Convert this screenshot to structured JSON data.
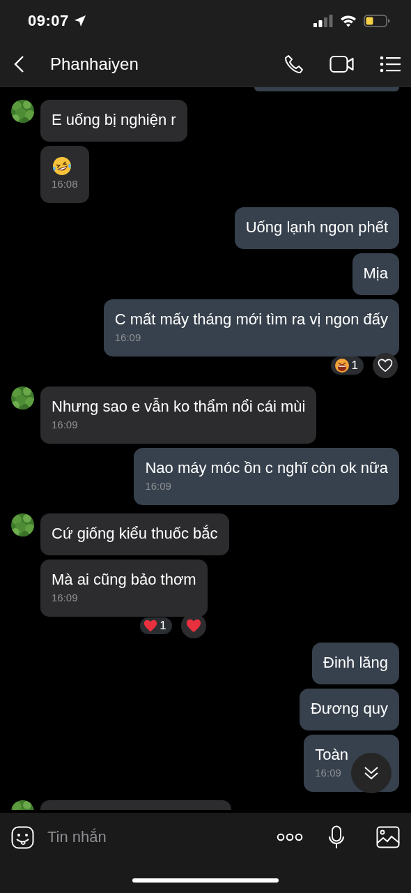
{
  "status_bar": {
    "time": "09:07"
  },
  "header": {
    "title": "Phanhaiyen"
  },
  "messages": [
    {
      "outgoing": true,
      "kind": "edge"
    },
    {
      "outgoing": false,
      "kind": "text",
      "avatar": true,
      "text": "E uống bị nghiện r"
    },
    {
      "outgoing": false,
      "kind": "emoji",
      "avatar": false,
      "time": "16:08"
    },
    {
      "outgoing": true,
      "kind": "text",
      "text": "Uống lạnh ngon phết"
    },
    {
      "outgoing": true,
      "kind": "text",
      "text": "Mịa"
    },
    {
      "outgoing": true,
      "kind": "text",
      "text": "C mất mấy tháng mới tìm ra vị ngon đấy",
      "time": "16:09",
      "reactions": {
        "kind": "laugh",
        "count": "1",
        "liked": false
      }
    },
    {
      "outgoing": false,
      "kind": "text",
      "avatar": true,
      "text": "Nhưng sao e vẫn ko thẩm nổi cái mùi",
      "time": "16:09"
    },
    {
      "outgoing": true,
      "kind": "text",
      "text": "Nao máy móc ồn c nghĩ còn ok nữa",
      "time": "16:09"
    },
    {
      "outgoing": false,
      "kind": "text",
      "avatar": true,
      "text": "Cứ giống kiểu thuốc bắc"
    },
    {
      "outgoing": false,
      "kind": "text",
      "avatar": false,
      "text": "Mà ai cũng bảo thơm",
      "time": "16:09",
      "reactions": {
        "kind": "heart",
        "count": "1",
        "liked": true
      }
    },
    {
      "outgoing": true,
      "kind": "text",
      "text": "Đinh lăng"
    },
    {
      "outgoing": true,
      "kind": "text",
      "text": "Đương quy"
    },
    {
      "outgoing": true,
      "kind": "text",
      "text": "Toàn",
      "time": "16:09"
    },
    {
      "outgoing": false,
      "kind": "edge",
      "avatar": true
    }
  ],
  "composer": {
    "placeholder": "Tin nhắn"
  }
}
